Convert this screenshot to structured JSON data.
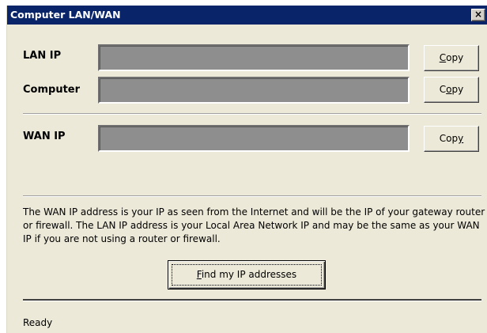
{
  "window": {
    "title": "Computer LAN/WAN",
    "close_glyph": "×"
  },
  "fields": {
    "lan_ip": {
      "label": "LAN IP",
      "value": "",
      "copy_label_pre": "",
      "copy_label_mnemonic": "C",
      "copy_label_post": "opy"
    },
    "computer": {
      "label": "Computer",
      "value": "",
      "copy_label_pre": "C",
      "copy_label_mnemonic": "o",
      "copy_label_post": "py"
    },
    "wan_ip": {
      "label": "WAN IP",
      "value": "",
      "copy_label_pre": "Cop",
      "copy_label_mnemonic": "y",
      "copy_label_post": ""
    }
  },
  "info": {
    "text": "The WAN IP address is your IP as seen from the Internet and will be the IP of your gateway router or firewall. The LAN IP address is your Local Area Network IP and may be the same as your WAN IP if you are not using a router or firewall."
  },
  "find_button": {
    "label_mnemonic": "F",
    "label_post": "ind my IP addresses"
  },
  "status": {
    "text": "Ready"
  },
  "colors": {
    "titlebar": "#0a246a",
    "window_bg": "#ece9d8",
    "field_bg": "#8e8e8e"
  },
  "icons": {
    "close": "close-icon"
  }
}
